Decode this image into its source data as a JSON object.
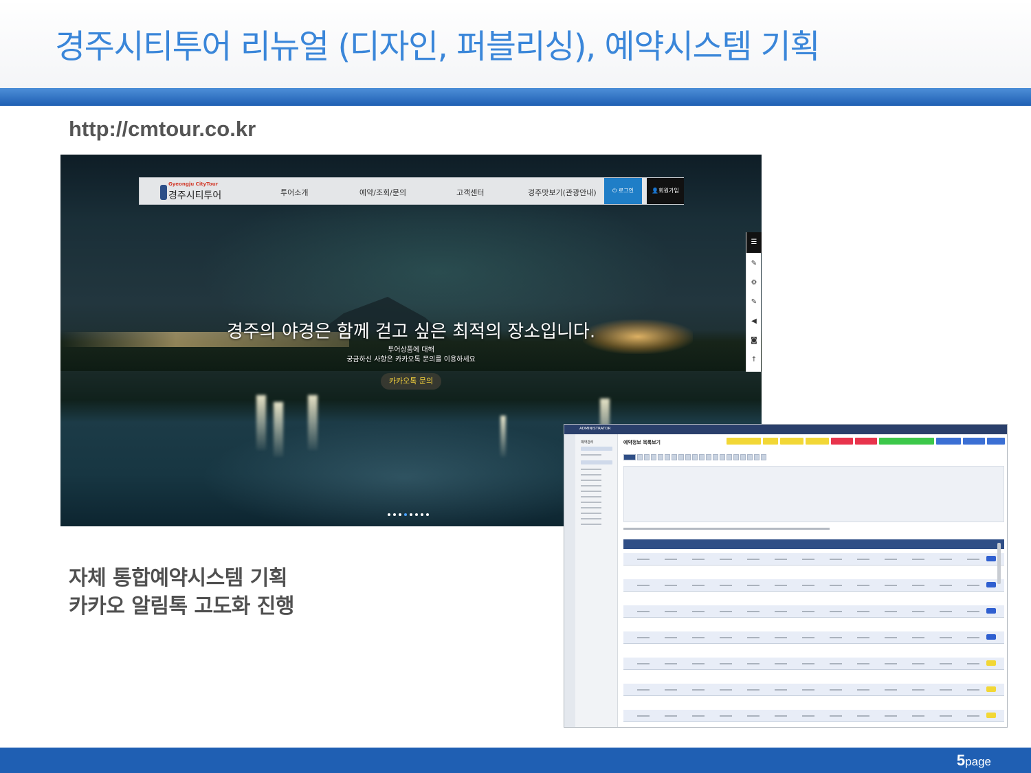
{
  "slide": {
    "title": "경주시티투어 리뉴얼 (디자인, 퍼블리싱), 예약시스템 기획",
    "url": "http://cmtour.co.kr",
    "caption_lines": [
      "자체 통합예약시스템 기획",
      "카카오 알림톡 고도화 진행"
    ],
    "page_number": "5",
    "page_label": "page",
    "colors": {
      "title": "#3a86d9",
      "bar": "#1f5fb3",
      "caption": "#505050"
    }
  },
  "site": {
    "logo_small": "Gyeongju CityTour",
    "logo_main": "경주시티투어",
    "menu": [
      "투어소개",
      "예약/조회/문의",
      "고객센터",
      "경주맛보기(관광안내)"
    ],
    "login_label": "로그인",
    "join_label": "회원가입",
    "headline": "경주의 야경은 함께 걷고 싶은 최적의 장소입니다.",
    "sub_line1": "투어상품에 대해",
    "sub_line2": "궁금하신 사항은 카카오톡 문의를 이용하세요",
    "kakao_button": "카카오톡 문의",
    "slide_indicator": {
      "count": 8,
      "active": 3
    },
    "quick_icons": [
      "menu-icon",
      "edit-icon",
      "settings-icon",
      "edit-icon",
      "speaker-icon",
      "camera-icon",
      "arrow-up-icon"
    ]
  },
  "admin": {
    "brand": "ADMINISTRATOR",
    "sidebar_title": "예약관리",
    "page_title": "예약정보 목록보기"
  }
}
